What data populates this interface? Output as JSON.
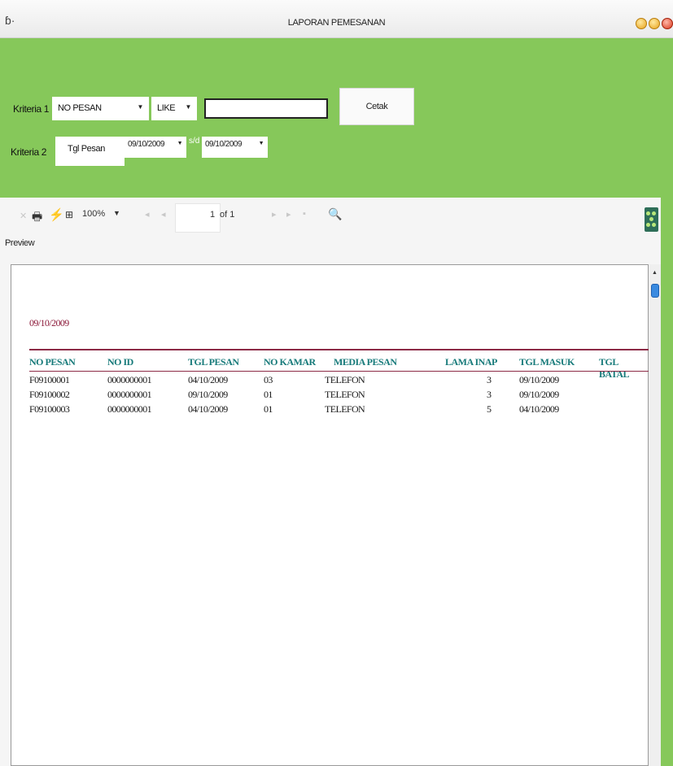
{
  "window": {
    "title": "LAPORAN PEMESANAN"
  },
  "criteria": {
    "label1": "Kriteria 1",
    "field_value": "NO PESAN",
    "operator_value": "LIKE",
    "search_value": "",
    "print_button": "Cetak",
    "label2": "Kriteria 2",
    "date_field": "Tgl Pesan",
    "date_from": "09/10/2009",
    "range_label": "s/d",
    "date_to": "09/10/2009"
  },
  "viewer": {
    "zoom": "100%",
    "page_current": "1",
    "page_total": "of 1",
    "tab_label": "Preview"
  },
  "report": {
    "date": "09/10/2009",
    "columns": [
      "NO PESAN",
      "NO ID",
      "TGL PESAN",
      "NO KAMAR",
      "MEDIA PESAN",
      "LAMA INAP",
      "TGL MASUK",
      "TGL BATAL"
    ],
    "rows": [
      {
        "no_pesan": "F09100001",
        "no_id": "0000000001",
        "tgl_pesan": "04/10/2009",
        "no_kamar": "03",
        "media": "TELEFON",
        "lama": "3",
        "tgl_masuk": "09/10/2009"
      },
      {
        "no_pesan": "F09100002",
        "no_id": "0000000001",
        "tgl_pesan": "09/10/2009",
        "no_kamar": "01",
        "media": "TELEFON",
        "lama": "3",
        "tgl_masuk": "09/10/2009"
      },
      {
        "no_pesan": "F09100003",
        "no_id": "0000000001",
        "tgl_pesan": "04/10/2009",
        "no_kamar": "01",
        "media": "TELEFON",
        "lama": "5",
        "tgl_masuk": "04/10/2009"
      }
    ]
  },
  "colors": {
    "panel": "#86c85a",
    "header_text": "#177a7a",
    "rule": "#8c2a46",
    "date_text": "#8c1a3a"
  },
  "icons": [
    "app-icon",
    "print-icon",
    "refresh-icon",
    "tree-icon",
    "search-icon",
    "crystal-logo-icon"
  ]
}
